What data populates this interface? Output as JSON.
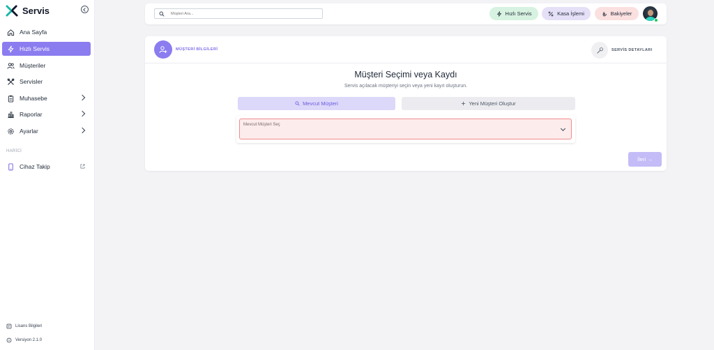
{
  "brand": {
    "name": "Servis"
  },
  "sidebar": {
    "items": [
      {
        "label": "Ana Sayfa",
        "icon": "home-icon"
      },
      {
        "label": "Hızlı Servis",
        "icon": "lightning-icon",
        "active": true
      },
      {
        "label": "Müşteriler",
        "icon": "users-icon"
      },
      {
        "label": "Servisler",
        "icon": "tools-icon"
      },
      {
        "label": "Muhasebe",
        "icon": "clipboard-icon",
        "has_submenu": true
      },
      {
        "label": "Raporlar",
        "icon": "bar-chart-icon",
        "has_submenu": true
      },
      {
        "label": "Ayarlar",
        "icon": "gear-icon",
        "has_submenu": true
      }
    ],
    "section_label": "HARİCİ",
    "external_items": [
      {
        "label": "Cihaz Takip",
        "icon": "phone-icon",
        "external": true
      }
    ],
    "footer": {
      "license_label": "Lisans Bilgileri",
      "version_label": "Versiyon 2.1.0"
    }
  },
  "topbar": {
    "search_placeholder": "Müşteri Ara...",
    "quick_service_label": "Hızlı Servis",
    "cash_label": "Kasa İşlemi",
    "balance_label": "Bakiyeler"
  },
  "steps": {
    "step1_label": "MÜŞTERİ BİLGİLERİ",
    "step2_label": "SERVİS DETAYLARI"
  },
  "main": {
    "title": "Müşteri Seçimi veya Kaydı",
    "subtitle": "Servis açılacak müşteriyi seçin veya yeni kayıt oluşturun.",
    "tab_existing": "Mevcut Müşteri",
    "tab_new": "Yeni Müşteri Oluştur",
    "select_placeholder": "Mevcut Müşteri Seç",
    "next_label": "İleri →"
  },
  "colors": {
    "accent": "#8b7cf0",
    "pill_green": "#d7f2e0",
    "pill_purple": "#e5e0f7",
    "pill_red": "#fbe0e0",
    "error_border": "#f08c8c"
  }
}
